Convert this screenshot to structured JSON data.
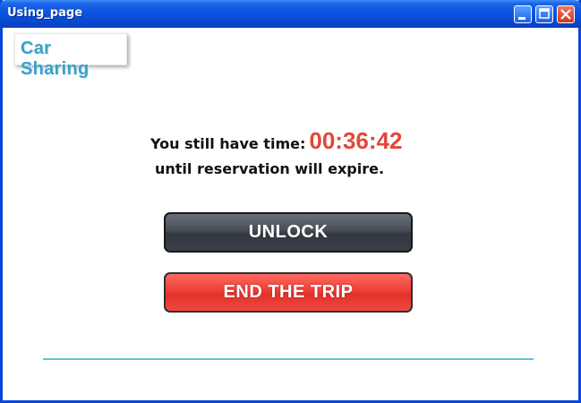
{
  "window": {
    "title": "Using_page",
    "controls": {
      "minimize": "minimize-icon",
      "maximize": "maximize-icon",
      "close": "close-icon"
    }
  },
  "logo": {
    "text": "Car Sharing"
  },
  "reservation": {
    "prefix": "You still have time:",
    "timer": "00:36:42",
    "suffix": "until reservation will expire."
  },
  "actions": {
    "unlock_label": "UNLOCK",
    "end_trip_label": "END THE TRIP"
  },
  "colors": {
    "titlebar": "#0a55e0",
    "logo_text": "#3aa0c8",
    "timer": "#e2473a",
    "unlock_button": "#3b4048",
    "end_button": "#ea3a32",
    "divider": "#5fc3dc"
  }
}
